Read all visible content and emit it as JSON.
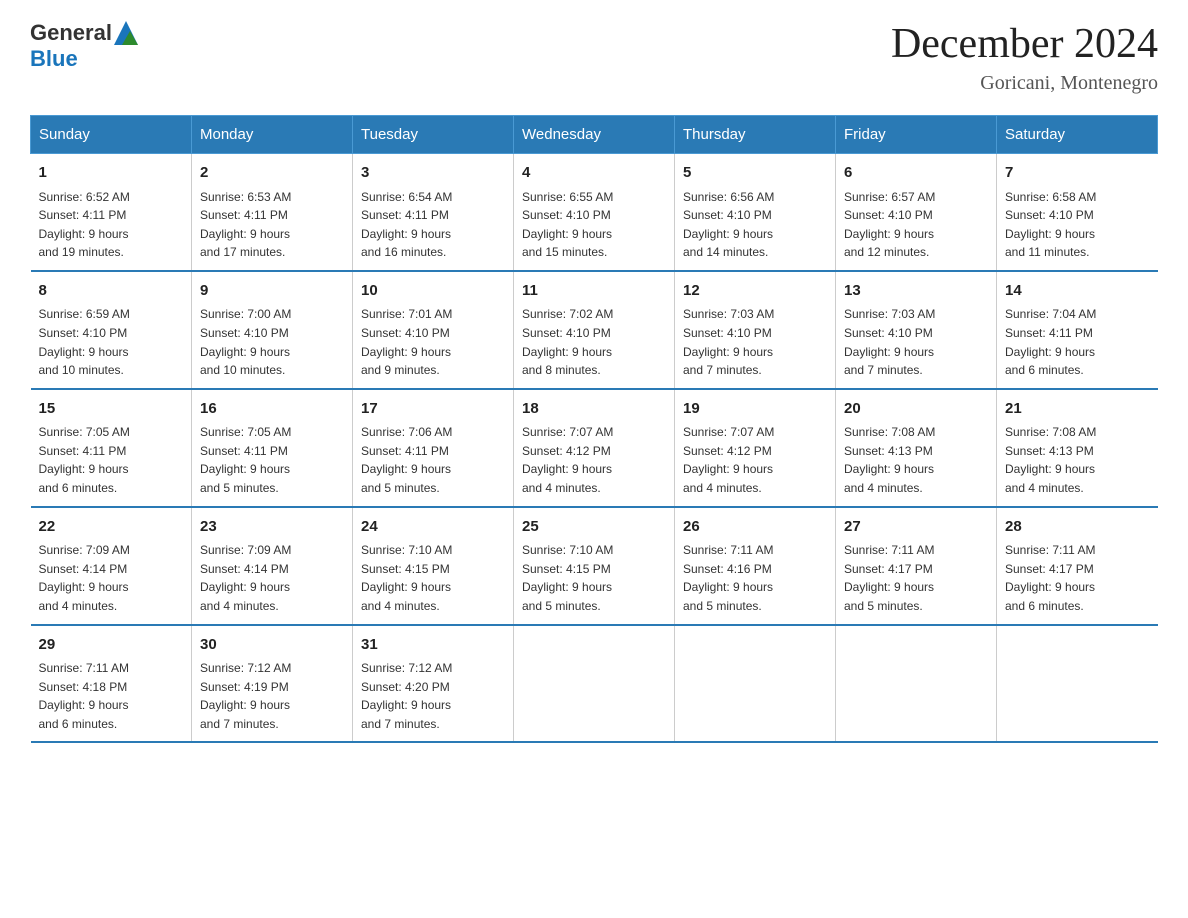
{
  "header": {
    "logo_general": "General",
    "logo_blue": "Blue",
    "month_title": "December 2024",
    "location": "Goricani, Montenegro"
  },
  "days_of_week": [
    "Sunday",
    "Monday",
    "Tuesday",
    "Wednesday",
    "Thursday",
    "Friday",
    "Saturday"
  ],
  "weeks": [
    [
      {
        "day": "1",
        "sunrise": "6:52 AM",
        "sunset": "4:11 PM",
        "daylight": "9 hours and 19 minutes."
      },
      {
        "day": "2",
        "sunrise": "6:53 AM",
        "sunset": "4:11 PM",
        "daylight": "9 hours and 17 minutes."
      },
      {
        "day": "3",
        "sunrise": "6:54 AM",
        "sunset": "4:11 PM",
        "daylight": "9 hours and 16 minutes."
      },
      {
        "day": "4",
        "sunrise": "6:55 AM",
        "sunset": "4:10 PM",
        "daylight": "9 hours and 15 minutes."
      },
      {
        "day": "5",
        "sunrise": "6:56 AM",
        "sunset": "4:10 PM",
        "daylight": "9 hours and 14 minutes."
      },
      {
        "day": "6",
        "sunrise": "6:57 AM",
        "sunset": "4:10 PM",
        "daylight": "9 hours and 12 minutes."
      },
      {
        "day": "7",
        "sunrise": "6:58 AM",
        "sunset": "4:10 PM",
        "daylight": "9 hours and 11 minutes."
      }
    ],
    [
      {
        "day": "8",
        "sunrise": "6:59 AM",
        "sunset": "4:10 PM",
        "daylight": "9 hours and 10 minutes."
      },
      {
        "day": "9",
        "sunrise": "7:00 AM",
        "sunset": "4:10 PM",
        "daylight": "9 hours and 10 minutes."
      },
      {
        "day": "10",
        "sunrise": "7:01 AM",
        "sunset": "4:10 PM",
        "daylight": "9 hours and 9 minutes."
      },
      {
        "day": "11",
        "sunrise": "7:02 AM",
        "sunset": "4:10 PM",
        "daylight": "9 hours and 8 minutes."
      },
      {
        "day": "12",
        "sunrise": "7:03 AM",
        "sunset": "4:10 PM",
        "daylight": "9 hours and 7 minutes."
      },
      {
        "day": "13",
        "sunrise": "7:03 AM",
        "sunset": "4:10 PM",
        "daylight": "9 hours and 7 minutes."
      },
      {
        "day": "14",
        "sunrise": "7:04 AM",
        "sunset": "4:11 PM",
        "daylight": "9 hours and 6 minutes."
      }
    ],
    [
      {
        "day": "15",
        "sunrise": "7:05 AM",
        "sunset": "4:11 PM",
        "daylight": "9 hours and 6 minutes."
      },
      {
        "day": "16",
        "sunrise": "7:05 AM",
        "sunset": "4:11 PM",
        "daylight": "9 hours and 5 minutes."
      },
      {
        "day": "17",
        "sunrise": "7:06 AM",
        "sunset": "4:11 PM",
        "daylight": "9 hours and 5 minutes."
      },
      {
        "day": "18",
        "sunrise": "7:07 AM",
        "sunset": "4:12 PM",
        "daylight": "9 hours and 4 minutes."
      },
      {
        "day": "19",
        "sunrise": "7:07 AM",
        "sunset": "4:12 PM",
        "daylight": "9 hours and 4 minutes."
      },
      {
        "day": "20",
        "sunrise": "7:08 AM",
        "sunset": "4:13 PM",
        "daylight": "9 hours and 4 minutes."
      },
      {
        "day": "21",
        "sunrise": "7:08 AM",
        "sunset": "4:13 PM",
        "daylight": "9 hours and 4 minutes."
      }
    ],
    [
      {
        "day": "22",
        "sunrise": "7:09 AM",
        "sunset": "4:14 PM",
        "daylight": "9 hours and 4 minutes."
      },
      {
        "day": "23",
        "sunrise": "7:09 AM",
        "sunset": "4:14 PM",
        "daylight": "9 hours and 4 minutes."
      },
      {
        "day": "24",
        "sunrise": "7:10 AM",
        "sunset": "4:15 PM",
        "daylight": "9 hours and 4 minutes."
      },
      {
        "day": "25",
        "sunrise": "7:10 AM",
        "sunset": "4:15 PM",
        "daylight": "9 hours and 5 minutes."
      },
      {
        "day": "26",
        "sunrise": "7:11 AM",
        "sunset": "4:16 PM",
        "daylight": "9 hours and 5 minutes."
      },
      {
        "day": "27",
        "sunrise": "7:11 AM",
        "sunset": "4:17 PM",
        "daylight": "9 hours and 5 minutes."
      },
      {
        "day": "28",
        "sunrise": "7:11 AM",
        "sunset": "4:17 PM",
        "daylight": "9 hours and 6 minutes."
      }
    ],
    [
      {
        "day": "29",
        "sunrise": "7:11 AM",
        "sunset": "4:18 PM",
        "daylight": "9 hours and 6 minutes."
      },
      {
        "day": "30",
        "sunrise": "7:12 AM",
        "sunset": "4:19 PM",
        "daylight": "9 hours and 7 minutes."
      },
      {
        "day": "31",
        "sunrise": "7:12 AM",
        "sunset": "4:20 PM",
        "daylight": "9 hours and 7 minutes."
      },
      null,
      null,
      null,
      null
    ]
  ],
  "labels": {
    "sunrise": "Sunrise:",
    "sunset": "Sunset:",
    "daylight": "Daylight:"
  }
}
